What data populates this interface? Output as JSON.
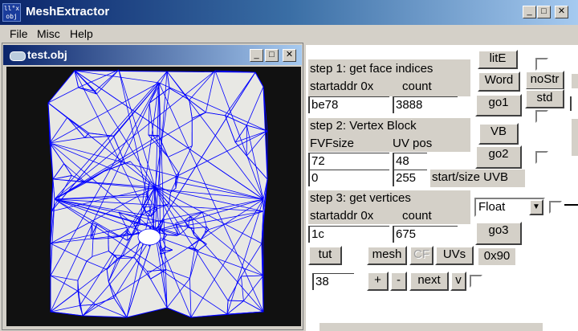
{
  "window": {
    "title": "MeshExtractor",
    "icon_text_1": "ll°x",
    "icon_text_2": "obj",
    "colors": {
      "titlebar": "#0a246a",
      "face": "#d4d0c8",
      "wire": "#0000ff"
    }
  },
  "menu": {
    "items": [
      "File",
      "Misc",
      "Help"
    ]
  },
  "child": {
    "title": "test.obj"
  },
  "step1": {
    "title": "step 1: get face indices",
    "addr_label": "startaddr 0x",
    "count_label": "count",
    "addr_value": "be78",
    "count_value": "3888"
  },
  "step2": {
    "title": "step 2: Vertex Block",
    "fvf_label": "FVFsize",
    "uv_label": "UV pos",
    "fvf_value": "72",
    "uv_value": "48",
    "start_value": "0",
    "size_value": "255",
    "uvb_label": "start/size UVB"
  },
  "step3": {
    "title": "step 3: get vertices",
    "addr_label": "startaddr 0x",
    "count_label": "count",
    "addr_value": "1c",
    "count_value": "675",
    "format_value": "Float"
  },
  "buttons": {
    "lite": "litE",
    "word": "Word",
    "nostr": "noStr",
    "std": "std",
    "go1": "go1",
    "vb": "VB",
    "go2": "go2",
    "go3": "go3",
    "tut": "tut",
    "mesh": "mesh",
    "cf": "CF",
    "uvs": "UVs",
    "hex": "0x90",
    "plus": "+",
    "minus": "-",
    "next": "next",
    "v": "v"
  },
  "stepper": {
    "value": "38"
  }
}
